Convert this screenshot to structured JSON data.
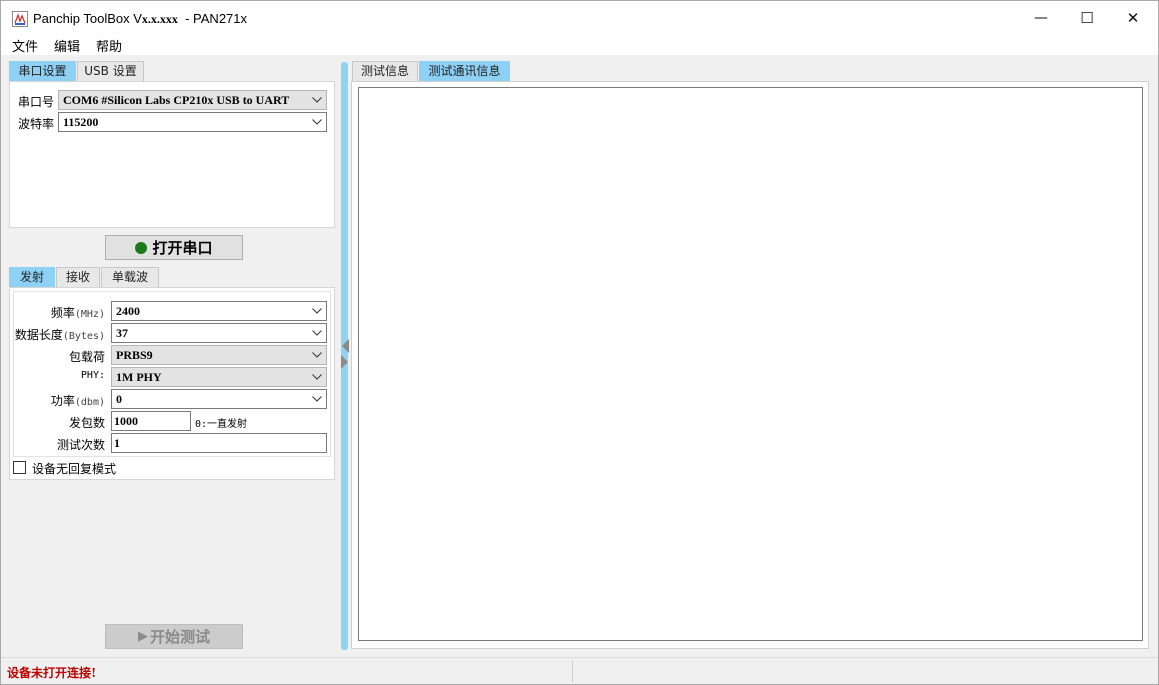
{
  "window": {
    "title": "Panchip ToolBox V",
    "title_version": "x.x.xxx",
    "title_suffix": "  - PAN271x",
    "controls": {
      "minimize": "—",
      "maximize": "☐",
      "close": "✕"
    }
  },
  "menu": [
    "文件",
    "编辑",
    "帮助"
  ],
  "left_tabs": {
    "tabs": [
      "串口设置",
      "USB 设置"
    ],
    "active": 0
  },
  "serial": {
    "port_label": "串口号",
    "port_value": "COM6 #Silicon Labs CP210x USB to UART",
    "baud_label": "波特率",
    "baud_value": "115200"
  },
  "open_button": {
    "label": "打开串口",
    "status_color": "#1c7a1c"
  },
  "mode_tabs": {
    "tabs": [
      "发射",
      "接收",
      "单载波"
    ],
    "active": 0
  },
  "tx": {
    "freq": {
      "label": "频率",
      "unit": "(MHz)",
      "value": "2400"
    },
    "length": {
      "label": "数据长度",
      "unit": "(Bytes)",
      "value": "37"
    },
    "payload": {
      "label": "包载荷",
      "value": "PRBS9"
    },
    "phy": {
      "label": "PHY:",
      "value": "1M PHY"
    },
    "power": {
      "label": "功率",
      "unit": "(dbm)",
      "value": "0"
    },
    "packets": {
      "label": "发包数",
      "value": "1000",
      "hint": "0:一直发射"
    },
    "tests": {
      "label": "测试次数",
      "value": "1"
    }
  },
  "no_reply_checkbox": {
    "label": "设备无回复模式",
    "checked": false
  },
  "start_button": {
    "label": "开始测试"
  },
  "right_tabs": {
    "tabs": [
      "测试信息",
      "测试通讯信息"
    ],
    "active": 1
  },
  "status": {
    "text": "设备未打开连接!",
    "color": "#c00000"
  },
  "colors": {
    "accent": "#8fd0f5",
    "splitter": "#8fd3f3"
  }
}
